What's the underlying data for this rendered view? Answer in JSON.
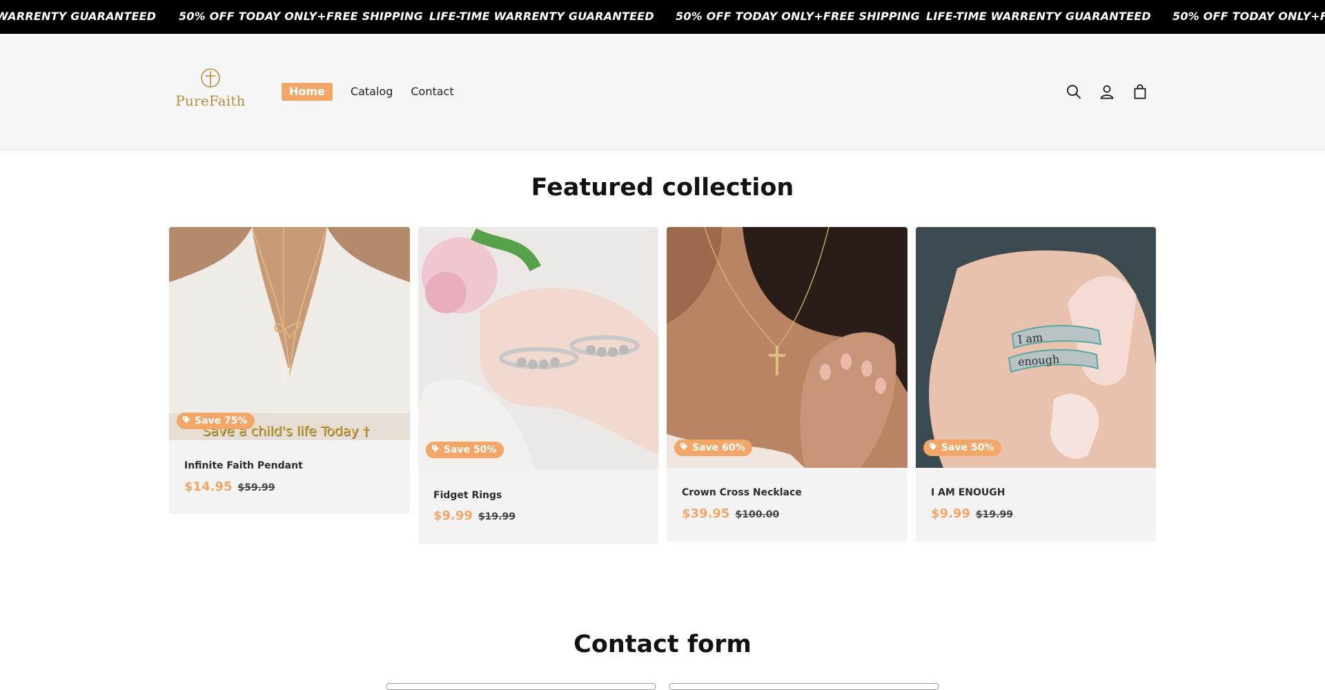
{
  "announcement": {
    "items": [
      "WARRENTY GUARANTEED",
      "50% OFF TODAY ONLY+FREE SHIPPING",
      "LIFE-TIME WARRENTY GUARANTEED",
      "50% OFF TODAY ONLY+FREE SHIPPING",
      "LIFE-TIME WARRENTY GUARANTEED",
      "50% OFF TODAY ONLY+FREE"
    ]
  },
  "header": {
    "logo_text": "PureFaith",
    "nav": [
      {
        "label": "Home",
        "active": true
      },
      {
        "label": "Catalog",
        "active": false
      },
      {
        "label": "Contact",
        "active": false
      }
    ],
    "icons": [
      "search-icon",
      "account-icon",
      "cart-icon"
    ]
  },
  "featured": {
    "title": "Featured collection",
    "products": [
      {
        "name": "Infinite Faith Pendant",
        "badge": "Save 75%",
        "price": "$14.95",
        "compare_price": "$59.99",
        "image_caption": "Save a child's life Today †"
      },
      {
        "name": "Fidget Rings",
        "badge": "Save 50%",
        "price": "$9.99",
        "compare_price": "$19.99"
      },
      {
        "name": "Crown Cross Necklace",
        "badge": "Save 60%",
        "price": "$39.95",
        "compare_price": "$100.00"
      },
      {
        "name": "I AM ENOUGH",
        "badge": "Save 50%",
        "price": "$9.99",
        "compare_price": "$19.99",
        "image_text": [
          "I am",
          "enough"
        ]
      }
    ]
  },
  "contact": {
    "title": "Contact form"
  },
  "colors": {
    "accent": "#f2a668",
    "announcement_bg": "#000000",
    "header_bg": "#f6f6f6",
    "logo_gold": "#b98b3a"
  }
}
